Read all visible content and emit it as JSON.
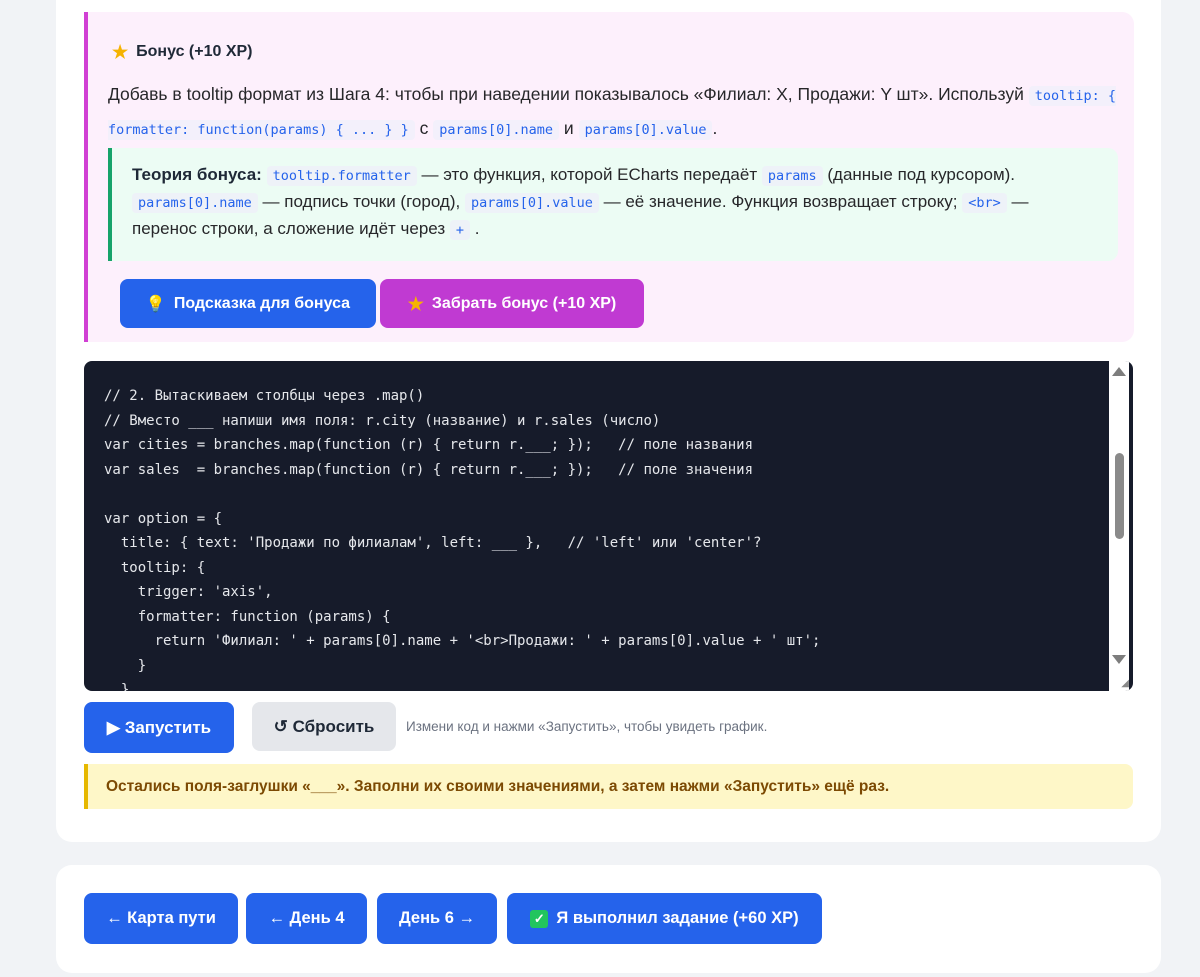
{
  "bonus": {
    "title": "Бонус (+10 XP)",
    "text_before": "Добавь в tooltip формат из Шага 4: чтобы при наведении показывалось «Филиал: X, Продажи: Y шт». Используй",
    "code_formatter": "tooltip: { formatter: function(params) { ... } }",
    "text_with": "с",
    "code_name": "params[0].name",
    "text_and": "и",
    "code_value": "params[0].value",
    "text_end": ".",
    "theory": {
      "label": "Теория бонуса:",
      "code_formatter": "tooltip.formatter",
      "t1": "— это функция, которой ECharts передаёт",
      "code_params": "params",
      "t2": "(данные под курсором).",
      "code_name": "params[0].name",
      "t3": "— подпись точки (город),",
      "code_value": "params[0].value",
      "t4": "— её значение. Функция возвращает строку;",
      "code_br": "<br>",
      "t5": "— перенос строки, а сложение идёт через",
      "code_plus": "+",
      "t6": "."
    },
    "hint_button": "Подсказка для бонуса",
    "claim_button": "Забрать бонус (+10 XP)"
  },
  "editor": {
    "code": "// 2. Вытаскиваем столбцы через .map()\n// Вместо ___ напиши имя поля: r.city (название) и r.sales (число)\nvar cities = branches.map(function (r) { return r.___; });   // поле названия\nvar sales  = branches.map(function (r) { return r.___; });   // поле значения\n\nvar option = {\n  title: { text: 'Продажи по филиалам', left: ___ },   // 'left' или 'center'?\n  tooltip: {\n    trigger: 'axis',\n    formatter: function (params) {\n      return 'Филиал: ' + params[0].name + '<br>Продажи: ' + params[0].value + ' шт';\n    }\n  },"
  },
  "controls": {
    "run_button": "▶ Запустить",
    "reset_button": "↺ Сбросить",
    "hint": "Измени код и нажми «Запустить», чтобы увидеть график."
  },
  "warning": "Остались поля-заглушки «___». Заполни их своими значениями, а затем нажми «Запустить» ещё раз.",
  "nav": {
    "map": "← Карта пути",
    "day4": "← День 4",
    "day6": "День 6 →",
    "done": "Я выполнил задание (+60 XP)"
  },
  "icons": {
    "bonus": "star-icon",
    "hint": "lightbulb-icon",
    "claim": "star-icon",
    "done": "check-icon"
  },
  "colors": {
    "primary": "#2563eb",
    "bonus_accent": "#c03ad2",
    "theory_accent": "#16a36a",
    "warning_accent": "#e6b800",
    "editor_bg": "#161b2a"
  }
}
